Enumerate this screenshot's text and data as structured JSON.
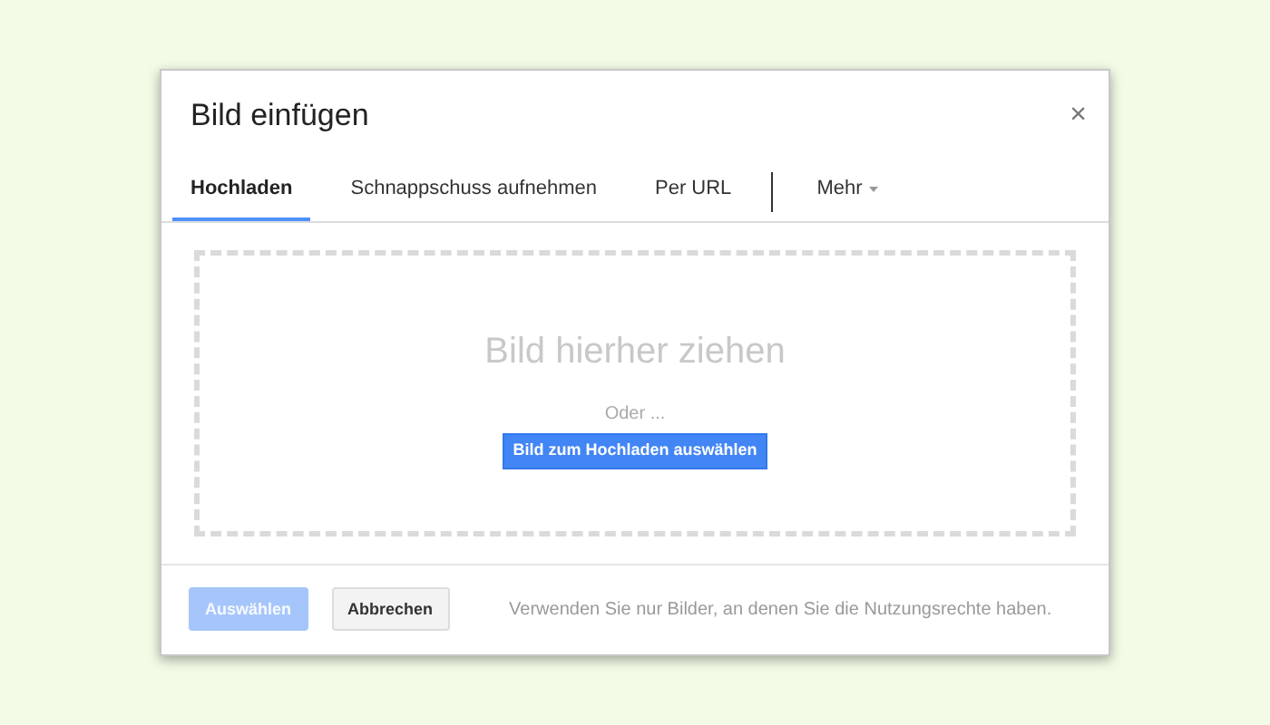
{
  "dialog": {
    "title": "Bild einfügen",
    "close": "×"
  },
  "tabs": [
    {
      "label": "Hochladen",
      "selected": true,
      "kind": "tab"
    },
    {
      "label": "Schnappschuss aufnehmen",
      "selected": false,
      "kind": "tab"
    },
    {
      "label": "Per URL",
      "selected": false,
      "kind": "tab"
    },
    {
      "label": "Mehr",
      "selected": false,
      "kind": "menu"
    }
  ],
  "drop_zone": {
    "heading": "Bild hierher ziehen",
    "separator": "Oder ...",
    "button": "Bild zum Hochladen auswählen"
  },
  "footer": {
    "buttons": [
      {
        "label": "Auswählen",
        "kind": "primary",
        "disabled": true
      },
      {
        "label": "Abbrechen",
        "kind": "secondary",
        "disabled": false
      }
    ],
    "note": "Verwenden Sie nur Bilder, an denen Sie die Nutzungsrechte haben."
  }
}
